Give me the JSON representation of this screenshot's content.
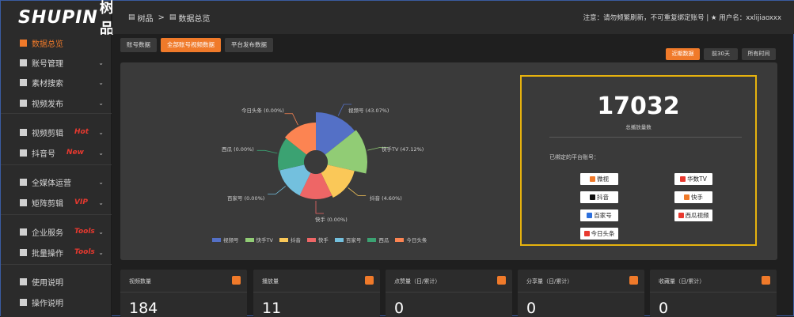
{
  "brand": {
    "logo": "SHUPIN",
    "logo_cn": "树品"
  },
  "sidebar": {
    "items": [
      {
        "label": "数据总览",
        "active": true,
        "chevron": ""
      },
      {
        "label": "账号管理",
        "chevron": "⌄"
      },
      {
        "label": "素材搜索",
        "chevron": "⌄"
      },
      {
        "label": "视频发布",
        "chevron": "⌄"
      },
      {
        "label": "视频剪辑",
        "tag": "Hot",
        "chevron": "⌄"
      },
      {
        "label": "抖音号",
        "tag": "New",
        "chevron": "⌄"
      },
      {
        "label": "全媒体运营",
        "chevron": "⌄"
      },
      {
        "label": "矩阵剪辑",
        "tag": "VIP",
        "chevron": "⌄"
      },
      {
        "label": "企业服务",
        "tag": "Tools",
        "chevron": "⌄"
      },
      {
        "label": "批量操作",
        "tag": "Tools",
        "chevron": "⌄"
      },
      {
        "label": "使用说明",
        "chevron": ""
      },
      {
        "label": "操作说明",
        "chevron": ""
      }
    ],
    "tag_colors": {
      "Hot": "#e8392f",
      "New": "#e8392f",
      "VIP": "#e8392f",
      "Tools": "#e8392f"
    }
  },
  "header": {
    "breadcrumb_home": "树品",
    "breadcrumb_sep": ">",
    "breadcrumb_current": "数据总览",
    "right_text": "注意：请勿频繁刷新，不可重复绑定账号 | ★ 用户名：xxlijiaoxxx"
  },
  "tabs": [
    "账号数据",
    "全部账号视频数据",
    "平台发布数据"
  ],
  "actions": [
    "近期数据",
    "前30天",
    "所有时间"
  ],
  "pie": {
    "labels": [
      {
        "text": "视频号 (43.07%)"
      },
      {
        "text": "快手TV (47.12%)"
      },
      {
        "text": "抖音 (4.60%)"
      },
      {
        "text": "快手 (0.00%)"
      },
      {
        "text": "百家号 (0.00%)"
      },
      {
        "text": "西瓜 (0.00%)"
      },
      {
        "text": "今日头条 (0.00%)"
      }
    ],
    "legend": [
      "视频号",
      "快手TV",
      "抖音",
      "快手",
      "百家号",
      "西瓜",
      "今日头条"
    ],
    "colors": [
      "#5470c6",
      "#91cc75",
      "#fac858",
      "#ee6666",
      "#73c0de",
      "#3ba272",
      "#fc8452"
    ]
  },
  "stats": {
    "total": "17032",
    "total_label": "总播放量数",
    "platforms_title": "已绑定的平台账号：",
    "platforms": [
      {
        "name": "微视",
        "color": "#f07a2a"
      },
      {
        "name": "华数TV",
        "color": "#e8392f"
      },
      {
        "name": "抖音",
        "color": "#111111"
      },
      {
        "name": "快手",
        "color": "#f07a2a"
      },
      {
        "name": "百家号",
        "color": "#2c6fdc"
      },
      {
        "name": "西瓜视频",
        "color": "#e8392f"
      },
      {
        "name": "今日头条",
        "color": "#e8392f"
      }
    ]
  },
  "cards": [
    {
      "title": "视频数量",
      "value": "184"
    },
    {
      "title": "播放量",
      "value": "11"
    },
    {
      "title": "点赞量（日/累计）",
      "value": "0"
    },
    {
      "title": "分享量（日/累计）",
      "value": "0"
    },
    {
      "title": "收藏量（日/累计）",
      "value": "0"
    }
  ],
  "chart_data": {
    "type": "pie",
    "categories": [
      "视频号",
      "快手TV",
      "抖音",
      "快手",
      "百家号",
      "西瓜",
      "今日头条"
    ],
    "values": [
      43.07,
      47.12,
      4.6,
      0.0,
      0.0,
      0.0,
      0.0
    ],
    "title": ""
  }
}
